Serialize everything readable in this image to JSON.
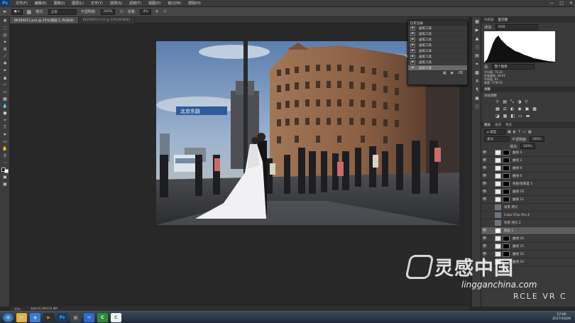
{
  "app": {
    "name": "Ps"
  },
  "menu": [
    "文件(F)",
    "编辑(E)",
    "图像(I)",
    "图层(L)",
    "文字(Y)",
    "选择(S)",
    "滤镜(T)",
    "视图(V)",
    "窗口(W)",
    "帮助(H)"
  ],
  "options": {
    "mode_label": "模式:",
    "mode_value": "正常",
    "opacity_label": "不透明度:",
    "opacity_value": "100%",
    "flow_label": "流量:",
    "flow_value": "4%"
  },
  "doc_tabs": [
    "8K294611.psd @ 25%(图层 1, RGB/8)",
    "8K294611.cr2 @ 25%(RGB/8)"
  ],
  "status": {
    "zoom": "25%",
    "doc": "文档:43.2M/372.8M"
  },
  "history_panel": {
    "title": "历史记录",
    "tabs2": "",
    "items": [
      "画笔工具",
      "画笔工具",
      "画笔工具",
      "画笔工具",
      "画笔工具",
      "画笔工具",
      "画笔工具",
      "画笔工具"
    ]
  },
  "right_panel": {
    "tab1": "导航器",
    "tab2": "直方图",
    "channel_label": "通道:",
    "channel_value": "RGB",
    "src_label": "源:",
    "src_value": "整个图像",
    "stats": [
      [
        "平均值:",
        "75.42"
      ],
      [
        "标准偏差:",
        "48.81"
      ],
      [
        "中间值:",
        "63"
      ],
      [
        "像素:",
        "579076"
      ]
    ],
    "adj_title": "调整",
    "adj_sub": "添加调整",
    "layers_tab": "图层",
    "layers_tab2": "通道",
    "layers_tab3": "路径",
    "kind": "ρ 类型",
    "blend": "柔光",
    "opacity_label": "不透明度:",
    "opacity_value": "100%",
    "fill_label": "填充:",
    "fill_value": "100%",
    "layers": [
      "曲线 4",
      "曲线 3",
      "曲线 9",
      "曲线 6",
      "色相/饱和度 1",
      "曲线 16",
      "曲线 11",
      "背景 拷贝",
      "Color Efex Pro 4",
      "背景 拷贝 2",
      "图层 1",
      "曲线 26",
      "曲线 25",
      "曲线 24",
      "曲线 23"
    ]
  },
  "watermark": {
    "cn": "灵感中国",
    "url": "lingganchina.com",
    "right": "RCLE VR C"
  },
  "clock": {
    "time": "17:00",
    "date": "2017/10/26"
  },
  "photo_signs": {
    "street": "北京东路"
  }
}
